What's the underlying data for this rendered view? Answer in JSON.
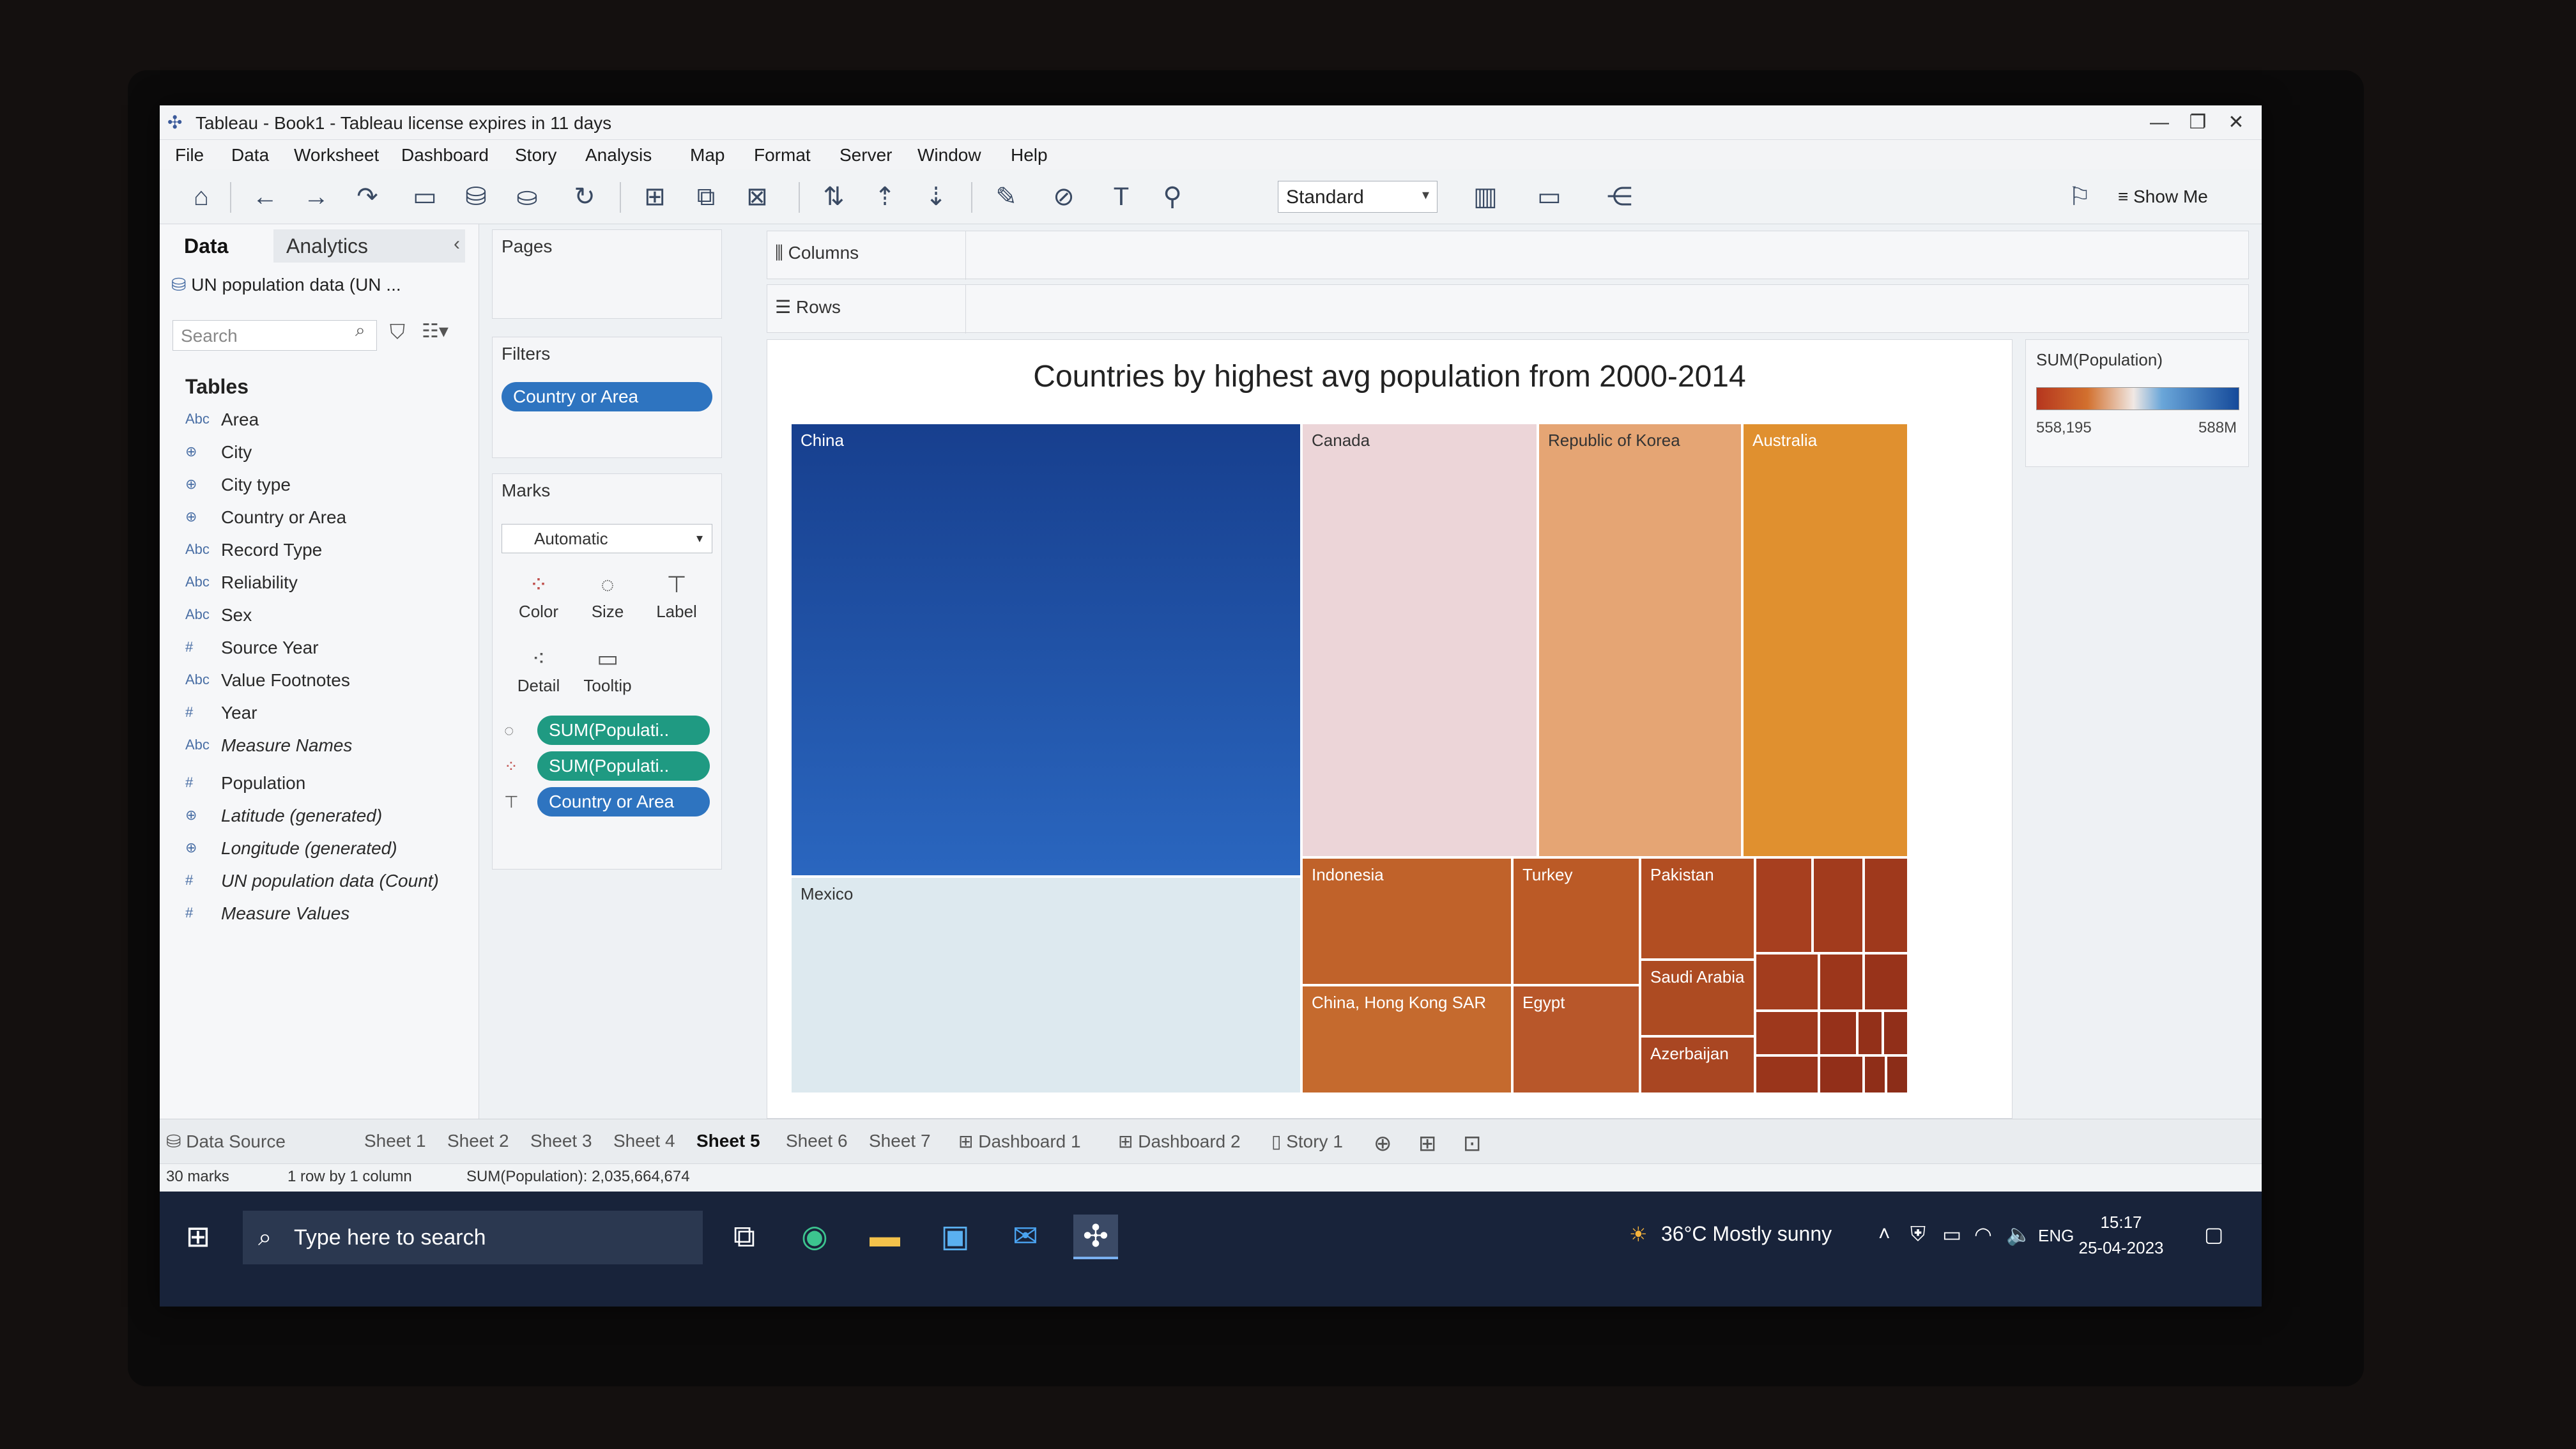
{
  "window": {
    "title": "Tableau - Book1 - Tableau license expires in 11 days",
    "controls": [
      "—",
      "❐",
      "✕"
    ]
  },
  "menu": [
    "File",
    "Data",
    "Worksheet",
    "Dashboard",
    "Story",
    "Analysis",
    "Map",
    "Format",
    "Server",
    "Window",
    "Help"
  ],
  "toolbar": {
    "view_size": "Standard",
    "show_me": "Show Me"
  },
  "data_pane": {
    "tabs": [
      "Data",
      "Analytics"
    ],
    "datasource": "UN population data (UN ...",
    "search_placeholder": "Search",
    "tables_heading": "Tables",
    "fields": [
      {
        "type": "Abc",
        "name": "Area"
      },
      {
        "type": "globe",
        "name": "City"
      },
      {
        "type": "globe",
        "name": "City type"
      },
      {
        "type": "globe",
        "name": "Country or Area"
      },
      {
        "type": "Abc",
        "name": "Record Type"
      },
      {
        "type": "Abc",
        "name": "Reliability"
      },
      {
        "type": "Abc",
        "name": "Sex"
      },
      {
        "type": "#",
        "name": "Source Year"
      },
      {
        "type": "Abc",
        "name": "Value Footnotes"
      },
      {
        "type": "#",
        "name": "Year"
      },
      {
        "type": "Abc",
        "name": "Measure Names"
      },
      {
        "type": "#",
        "name": "Population"
      },
      {
        "type": "globe",
        "name": "Latitude (generated)"
      },
      {
        "type": "globe",
        "name": "Longitude (generated)"
      },
      {
        "type": "#",
        "name": "UN population data (Count)"
      },
      {
        "type": "#",
        "name": "Measure Values"
      }
    ]
  },
  "pages": {
    "title": "Pages"
  },
  "filters": {
    "title": "Filters",
    "pill": "Country or Area"
  },
  "marks": {
    "title": "Marks",
    "type": "Automatic",
    "buttons": [
      "Color",
      "Size",
      "Label",
      "Detail",
      "Tooltip"
    ],
    "pills": [
      "SUM(Populati..",
      "SUM(Populati..",
      "Country or Area"
    ]
  },
  "shelves": {
    "columns": "Columns",
    "rows": "Rows"
  },
  "viz": {
    "title": "Countries by highest avg population from 2000-2014",
    "tiles": [
      "China",
      "Mexico",
      "Canada",
      "Republic of Korea",
      "Australia",
      "Indonesia",
      "Turkey",
      "Pakistan",
      "China, Hong Kong SAR",
      "Egypt",
      "Saudi Arabia",
      "Azerbaijan"
    ]
  },
  "legend": {
    "title": "SUM(Population)",
    "min": "558,195",
    "max": "588M"
  },
  "sheets": [
    "Data Source",
    "Sheet 1",
    "Sheet 2",
    "Sheet 3",
    "Sheet 4",
    "Sheet 5",
    "Sheet 6",
    "Sheet 7",
    "Dashboard 1",
    "Dashboard 2",
    "Story 1"
  ],
  "status": {
    "marks": "30 marks",
    "rows": "1 row by 1 column",
    "sum": "SUM(Population): 2,035,664,674"
  },
  "taskbar": {
    "search_placeholder": "Type here to search",
    "weather": "36°C  Mostly sunny",
    "lang": "ENG",
    "time": "15:17",
    "date": "25-04-2023"
  },
  "colors": {
    "accent_blue": "#2e74c0",
    "accent_green": "#1f9a82"
  }
}
